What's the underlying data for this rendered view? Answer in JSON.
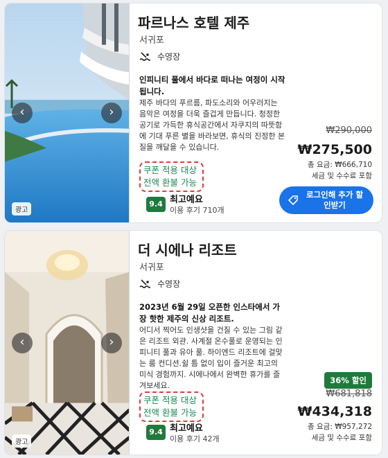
{
  "listings": [
    {
      "title": "파르나스 호텔 제주",
      "location": "서귀포",
      "amenity": "수영장",
      "headline": "인피니티 풀에서 바다로 떠나는 여정이 시작됩니다.",
      "description": "제주 바다의 푸르름, 파도소리와 어우러지는 음악은 여정을 더욱 즐겁게 만듭니다. 청정한 공기로 가득한 휴식공간에서 자쿠지의 따뜻함에 기대 푸른 별을 바라보면, 휴식의 진정한 본질을 깨달을 수 있습니다.",
      "coupon_line1": "쿠폰 적용 대상",
      "coupon_line2": "전액 환불 가능",
      "rating": "9.4",
      "rating_word": "최고예요",
      "review_count": "이용 후기 710개",
      "original_price": "₩290,000",
      "price": "₩275,500",
      "total": "총 요금: ₩666,710",
      "tax_note": "세금 및 수수료 포함",
      "login_button": "로그인해 추가 할인받기",
      "ad_label": "광고"
    },
    {
      "title": "더 시에나 리조트",
      "location": "서귀포",
      "amenity": "수영장",
      "headline": "2023년 6월 29일 오픈한 인스타에서 가장 핫한 제주의 신상 리조트.",
      "description": "어디서 찍어도 인생샷을 건질 수 있는 그림 같은 리조트 외관. 사계절 온수풀로 운영되는 인피니티 풀과 유아 풀. 하이엔드 리조트에 걸맞는 룸 컨디션.쉴 틈 없이 입이 즐거운 최고의 미식 경험까지. 시에나에서 완벽한 휴가를 즐겨보세요.",
      "coupon_line1": "쿠폰 적용 대상",
      "coupon_line2": "전액 환불 가능",
      "rating": "9.4",
      "rating_word": "최고예요",
      "review_count": "이용 후기 42개",
      "discount_badge": "36% 할인",
      "original_price": "₩681,818",
      "price": "₩434,318",
      "total": "총 요금: ₩957,272",
      "tax_note": "세금 및 수수료 포함",
      "ad_label": "광고"
    }
  ],
  "icons": {
    "prev": "chevron-left-icon",
    "next": "chevron-right-icon",
    "pool": "pool-icon",
    "tag": "tag-icon"
  },
  "colors": {
    "accent": "#1a73e8",
    "rating_bg": "#1f7a3c",
    "coupon_text": "#198754",
    "coupon_border": "#e03a3a"
  }
}
